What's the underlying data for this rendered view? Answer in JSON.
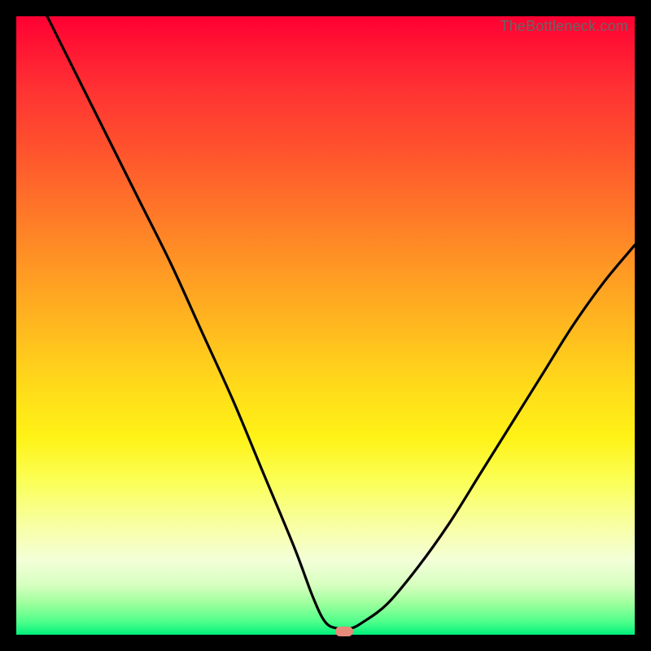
{
  "watermark": "TheBottleneck.com",
  "chart_data": {
    "type": "line",
    "title": "",
    "xlabel": "",
    "ylabel": "",
    "xlim": [
      0,
      100
    ],
    "ylim": [
      0,
      100
    ],
    "grid": false,
    "legend": false,
    "series": [
      {
        "name": "bottleneck-curve",
        "x": [
          5,
          10,
          15,
          20,
          25,
          30,
          35,
          40,
          45,
          48,
          50,
          52,
          54,
          56,
          60,
          65,
          70,
          75,
          80,
          85,
          90,
          95,
          100
        ],
        "values": [
          100,
          90,
          80,
          70,
          60,
          49,
          38,
          26,
          14,
          6,
          2,
          1,
          1,
          2,
          5,
          11,
          18,
          26,
          34,
          42,
          50,
          57,
          63
        ]
      }
    ],
    "marker": {
      "x": 53,
      "y": 0.5
    },
    "background_gradient": {
      "top_color": "#ff0033",
      "mid_color": "#ffe020",
      "bottom_color": "#00f07a"
    }
  },
  "colors": {
    "curve": "#000000",
    "marker": "#e88a7a",
    "frame": "#000000"
  }
}
